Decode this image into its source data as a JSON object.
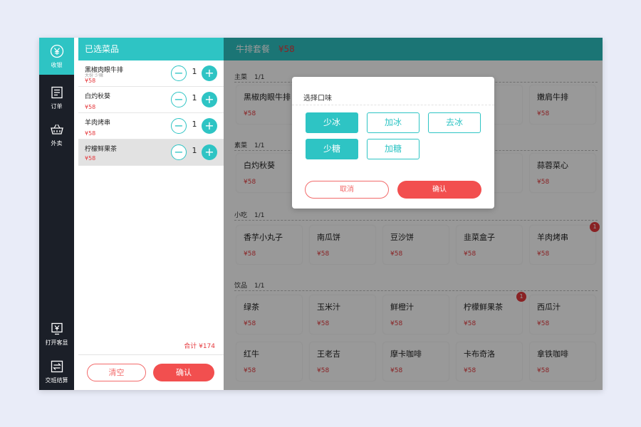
{
  "nav": {
    "items": [
      {
        "label": "收银",
        "icon": "yen-circle-icon"
      },
      {
        "label": "订单",
        "icon": "order-list-icon"
      },
      {
        "label": "外卖",
        "icon": "basket-icon"
      },
      {
        "label": "打开客显",
        "icon": "customer-display-icon"
      },
      {
        "label": "交班结算",
        "icon": "shift-settle-icon"
      }
    ]
  },
  "cart": {
    "title": "已选菜品",
    "items": [
      {
        "name": "黑椒肉眼牛排",
        "sub": "大份 少辣",
        "price": "¥58",
        "qty": "1"
      },
      {
        "name": "白灼秋葵",
        "sub": "",
        "price": "¥58",
        "qty": "1"
      },
      {
        "name": "羊肉烤串",
        "sub": "",
        "price": "¥58",
        "qty": "1"
      },
      {
        "name": "柠檬鲜果茶",
        "sub": "",
        "price": "¥58",
        "qty": "1"
      }
    ],
    "total": "合计 ¥174",
    "clear_label": "清空",
    "confirm_label": "确认"
  },
  "menu": {
    "title": "牛排套餐",
    "price": "¥58",
    "categories": [
      {
        "name": "主菜",
        "count": "1/1",
        "items": [
          {
            "name": "黑椒肉眼牛排",
            "price": "¥58"
          },
          {
            "name": "",
            "price": ""
          },
          {
            "name": "",
            "price": ""
          },
          {
            "name": "",
            "price": ""
          },
          {
            "name": "嫩肩牛排",
            "price": "¥58"
          }
        ]
      },
      {
        "name": "素菜",
        "count": "1/1",
        "items": [
          {
            "name": "白灼秋葵",
            "price": "¥58"
          },
          {
            "name": "",
            "price": ""
          },
          {
            "name": "",
            "price": ""
          },
          {
            "name": "",
            "price": ""
          },
          {
            "name": "蒜蓉菜心",
            "price": "¥58"
          }
        ]
      },
      {
        "name": "小吃",
        "count": "1/1",
        "items": [
          {
            "name": "香芋小丸子",
            "price": "¥58"
          },
          {
            "name": "南瓜饼",
            "price": "¥58"
          },
          {
            "name": "豆沙饼",
            "price": "¥58"
          },
          {
            "name": "韭菜盒子",
            "price": "¥58"
          },
          {
            "name": "羊肉烤串",
            "price": "¥58",
            "badge": "1"
          }
        ]
      },
      {
        "name": "饮品",
        "count": "1/1",
        "items": [
          {
            "name": "绿茶",
            "price": "¥58"
          },
          {
            "name": "玉米汁",
            "price": "¥58"
          },
          {
            "name": "鲜橙汁",
            "price": "¥58"
          },
          {
            "name": "柠檬鲜果茶",
            "price": "¥58",
            "badge": "1"
          },
          {
            "name": "西瓜汁",
            "price": "¥58"
          },
          {
            "name": "红牛",
            "price": "¥58"
          },
          {
            "name": "王老吉",
            "price": "¥58"
          },
          {
            "name": "摩卡咖啡",
            "price": "¥58"
          },
          {
            "name": "卡布奇洛",
            "price": "¥58"
          },
          {
            "name": "拿铁咖啡",
            "price": "¥58"
          }
        ]
      }
    ]
  },
  "dialog": {
    "title": "选择口味",
    "options": [
      {
        "label": "少冰",
        "selected": true
      },
      {
        "label": "加冰",
        "selected": false
      },
      {
        "label": "去冰",
        "selected": false
      },
      {
        "label": "少糖",
        "selected": true
      },
      {
        "label": "加糖",
        "selected": false
      }
    ],
    "cancel_label": "取消",
    "confirm_label": "确认"
  },
  "colors": {
    "accent": "#2ec4c4",
    "price": "#e5393d",
    "nav_bg": "#1b1f28",
    "danger_button": "#f24f4f"
  }
}
